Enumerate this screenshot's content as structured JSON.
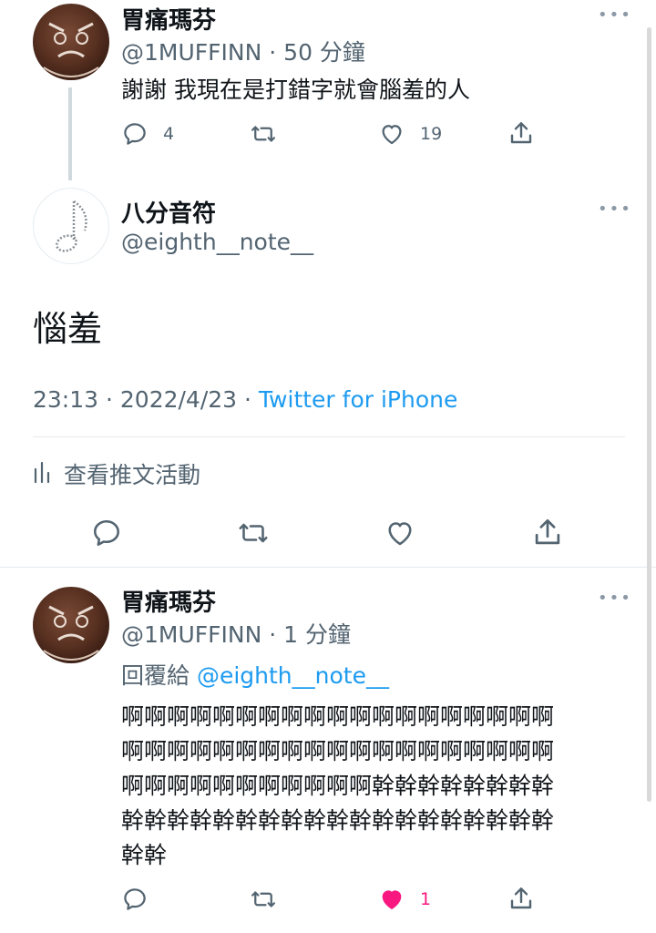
{
  "tweet1": {
    "display_name": "胃痛瑪芬",
    "handle": "@1MUFFINN",
    "time_sep": "·",
    "time": "50 分鐘",
    "text": "謝謝 我現在是打錯字就會腦羞的人",
    "reply_count": "4",
    "like_count": "19"
  },
  "main_tweet": {
    "display_name": "八分音符",
    "handle": "@eighth__note__",
    "text": "惱羞",
    "timestamp": "23:13 · 2022/4/23 ·",
    "source": "Twitter for iPhone",
    "activity_label": "查看推文活動"
  },
  "reply": {
    "display_name": "胃痛瑪芬",
    "handle": "@1MUFFINN",
    "time_sep": "·",
    "time": "1 分鐘",
    "replying_prefix": "回覆給",
    "replying_to": "@eighth__note__",
    "text_lines": [
      "啊啊啊啊啊啊啊啊啊啊啊啊啊啊啊啊啊啊啊",
      "啊啊啊啊啊啊啊啊啊啊啊啊啊啊啊啊啊啊啊",
      "啊啊啊啊啊啊啊啊啊啊啊幹幹幹幹幹幹幹幹",
      "幹幹幹幹幹幹幹幹幹幹幹幹幹幹幹幹幹幹幹",
      "幹幹"
    ],
    "like_count": "1"
  },
  "colors": {
    "like_active": "#f91880",
    "link": "#1d9bf0",
    "secondary": "#536471"
  }
}
